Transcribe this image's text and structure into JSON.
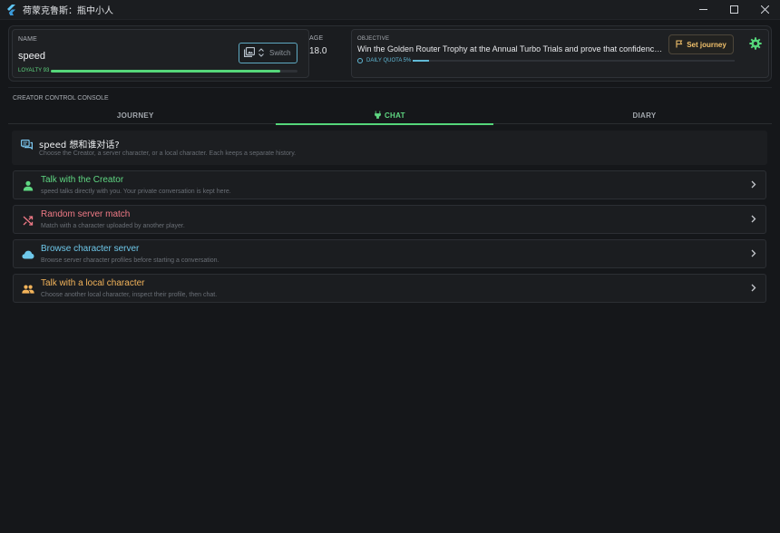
{
  "window": {
    "title": "荷蒙克鲁斯：瓶中小人",
    "controls": [
      "minimize",
      "maximize",
      "close"
    ]
  },
  "header": {
    "name": {
      "label": "NAME",
      "value": "speed",
      "switch_label": "Switch"
    },
    "loyalty": {
      "label": "LOYALTY 93",
      "value": 93,
      "max": 100
    },
    "age": {
      "label": "AGE",
      "value": "18.0"
    },
    "objective": {
      "label": "OBJECTIVE",
      "text": "Win the Golden Router Trophy at the Annual Turbo Trials and prove that confidence is more important than raw power",
      "quota_label": "DAILY QUOTA 5%",
      "quota_value": 5
    },
    "set_journey_label": "Set journey"
  },
  "console": {
    "title": "CREATOR CONTROL CONSOLE",
    "tabs": [
      {
        "label": "JOURNEY",
        "active": false
      },
      {
        "label": "CHAT",
        "active": true
      },
      {
        "label": "DIARY",
        "active": false
      }
    ],
    "prompt": {
      "title": "speed 想和谁对话?",
      "subtitle": "Choose the Creator, a server character, or a local character. Each keeps a separate history."
    },
    "options": [
      {
        "title": "Talk with the Creator",
        "subtitle": "speed talks directly with you. Your private conversation is kept here.",
        "icon": "person-icon",
        "color": "#5fd782"
      },
      {
        "title": "Random server match",
        "subtitle": "Match with a character uploaded by another player.",
        "icon": "shuffle-icon",
        "color": "#f07a86"
      },
      {
        "title": "Browse character server",
        "subtitle": "Browse server character profiles before starting a conversation.",
        "icon": "cloud-icon",
        "color": "#6ec8ea"
      },
      {
        "title": "Talk with a local character",
        "subtitle": "Choose another local character, inspect their profile, then chat.",
        "icon": "group-icon",
        "color": "#f2b35a"
      }
    ]
  },
  "colors": {
    "accent_green": "#55d67a",
    "accent_blue": "#61b9d6",
    "accent_gold": "#f0c06b",
    "background": "#15171a"
  }
}
